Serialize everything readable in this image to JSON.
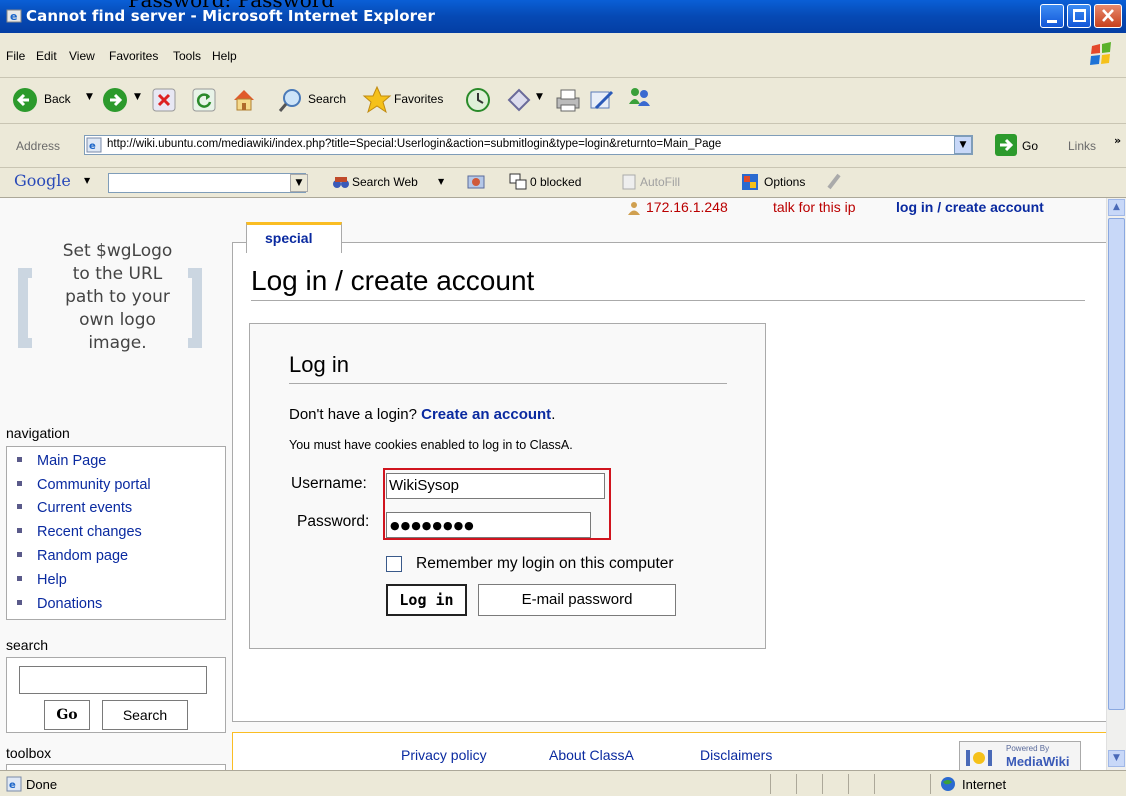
{
  "window": {
    "title": "Cannot find server - Microsoft Internet Explorer",
    "top_cut_text": "Password: Password"
  },
  "menu": [
    "File",
    "Edit",
    "View",
    "Favorites",
    "Tools",
    "Help"
  ],
  "toolbar": {
    "back": "Back",
    "search": "Search",
    "favorites": "Favorites"
  },
  "address": {
    "label": "Address",
    "url": "http://wiki.ubuntu.com/mediawiki/index.php?title=Special:Userlogin&action=submitlogin&type=login&returnto=Main_Page",
    "go": "Go",
    "links": "Links"
  },
  "googlebar": {
    "logo": "Google",
    "search_web": "Search Web",
    "blocked": "0 blocked",
    "autofill": "AutoFill",
    "options": "Options"
  },
  "personal": {
    "ip": "172.16.1.248",
    "talk": "talk for this ip",
    "login": "log in / create account"
  },
  "logo_text": [
    "Set $wgLogo",
    "to the URL",
    "path to your",
    "own logo",
    "image."
  ],
  "navigation": {
    "title": "navigation",
    "items": [
      "Main Page",
      "Community portal",
      "Current events",
      "Recent changes",
      "Random page",
      "Help",
      "Donations"
    ]
  },
  "search": {
    "title": "search",
    "go": "Go",
    "search": "Search"
  },
  "toolbox": {
    "title": "toolbox"
  },
  "tab": {
    "label": "special"
  },
  "page": {
    "heading": "Log in / create account"
  },
  "login": {
    "heading": "Log in",
    "no_login": "Don't have a login?",
    "create_link": "Create an account",
    "cookies": "You must have cookies enabled to log in to ClassA.",
    "username_label": "Username:",
    "username_value": "WikiSysop",
    "password_label": "Password:",
    "password_value": "●●●●●●●●",
    "remember": "Remember my login on this computer",
    "login_button": "Log in",
    "email_button": "E-mail password"
  },
  "footer": {
    "privacy": "Privacy policy",
    "about": "About ClassA",
    "disclaimers": "Disclaimers",
    "powered_small": "Powered By",
    "powered": "MediaWiki"
  },
  "status": {
    "left": "Done",
    "zone": "Internet"
  },
  "colors": {
    "link": "#0a2aa0",
    "title_bar": "#0649b4",
    "highlight_box": "#d0141e",
    "tab_border": "#fabd23"
  }
}
